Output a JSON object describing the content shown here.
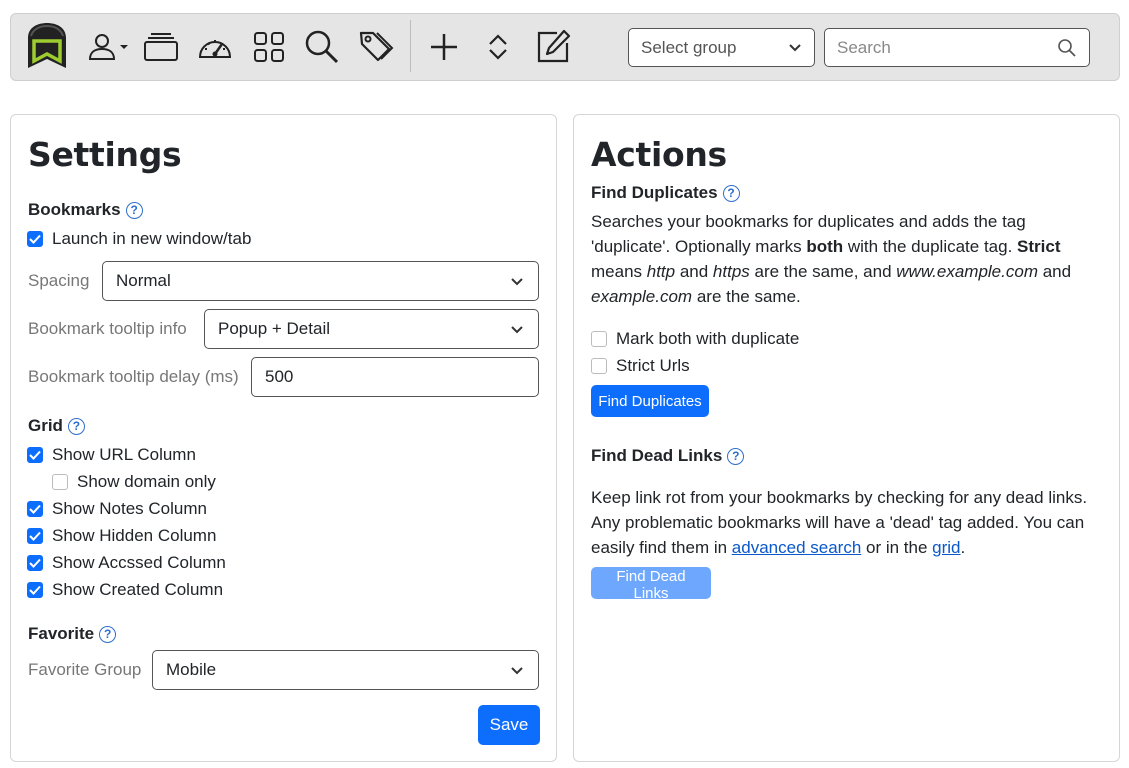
{
  "toolbar": {
    "icons": [
      "app-logo-icon",
      "user-icon",
      "collections-icon",
      "dashboard-icon",
      "grid-icon",
      "search-icon",
      "tags-icon",
      "add-icon",
      "sort-icon",
      "edit-icon"
    ],
    "select_group_placeholder": "Select group",
    "search_placeholder": "Search"
  },
  "settings": {
    "title": "Settings",
    "bookmarks": {
      "heading": "Bookmarks",
      "launch_new_window_label": "Launch in new window/tab",
      "launch_new_window_checked": true,
      "spacing_label": "Spacing",
      "spacing_value": "Normal",
      "tooltip_info_label": "Bookmark tooltip info",
      "tooltip_info_value": "Popup + Detail",
      "tooltip_delay_label": "Bookmark tooltip delay (ms)",
      "tooltip_delay_value": "500"
    },
    "grid": {
      "heading": "Grid",
      "options": [
        {
          "label": "Show URL Column",
          "checked": true
        },
        {
          "label": "Show domain only",
          "checked": false
        },
        {
          "label": "Show Notes Column",
          "checked": true
        },
        {
          "label": "Show Hidden Column",
          "checked": true
        },
        {
          "label": "Show Accssed Column",
          "checked": true
        },
        {
          "label": "Show Created Column",
          "checked": true
        }
      ]
    },
    "favorite": {
      "heading": "Favorite",
      "group_label": "Favorite Group",
      "group_value": "Mobile"
    },
    "save_label": "Save"
  },
  "actions": {
    "title": "Actions",
    "find_duplicates": {
      "heading": "Find Duplicates",
      "desc_1": "Searches your bookmarks for duplicates and adds the tag 'duplicate'. Optionally marks ",
      "desc_both": "both",
      "desc_2": " with the duplicate tag. ",
      "desc_strict": "Strict",
      "desc_3": " means ",
      "desc_http": "http",
      "desc_4": " and ",
      "desc_https": "https",
      "desc_5": " are the same, and ",
      "desc_www": "www.example.com",
      "desc_6": " and ",
      "desc_example": "example.com",
      "desc_7": " are the same.",
      "mark_both_label": "Mark both with duplicate",
      "mark_both_checked": false,
      "strict_urls_label": "Strict Urls",
      "strict_urls_checked": false,
      "button_label": "Find Duplicates"
    },
    "find_dead_links": {
      "heading": "Find Dead Links",
      "desc_1": "Keep link rot from your bookmarks by checking for any dead links. Any problematic bookmarks will have a 'dead' tag added. You can easily find them in ",
      "link_advanced": "advanced search",
      "desc_2": " or in the ",
      "link_grid": "grid",
      "desc_3": ".",
      "button_label": "Find Dead Links"
    }
  },
  "colors": {
    "primary": "#0d6efd",
    "primary_disabled": "#6ea8fe",
    "toolbar_bg": "#e5e5e5",
    "logo_green": "#8bc34a"
  }
}
